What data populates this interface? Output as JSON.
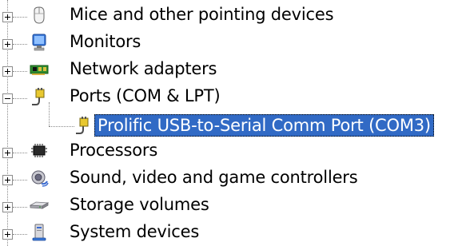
{
  "tree": {
    "nodes": [
      {
        "label": "Mice and other pointing devices",
        "icon": "mouse-icon",
        "expander": "plus"
      },
      {
        "label": "Monitors",
        "icon": "monitor-icon",
        "expander": "plus"
      },
      {
        "label": "Network adapters",
        "icon": "network-adapter-icon",
        "expander": "plus"
      },
      {
        "label": "Ports (COM & LPT)",
        "icon": "port-connector-icon",
        "expander": "minus"
      },
      {
        "label": "Prolific USB-to-Serial Comm Port (COM3)",
        "icon": "port-connector-icon",
        "selected": true
      },
      {
        "label": "Processors",
        "icon": "processor-icon",
        "expander": "plus"
      },
      {
        "label": "Sound, video and game controllers",
        "icon": "speaker-icon",
        "expander": "plus"
      },
      {
        "label": "Storage volumes",
        "icon": "storage-volume-icon",
        "expander": "plus"
      },
      {
        "label": "System devices",
        "icon": "computer-icon",
        "expander": "plus"
      }
    ]
  },
  "colors": {
    "selection_background": "#316ac5",
    "selection_text": "#ffffff"
  }
}
